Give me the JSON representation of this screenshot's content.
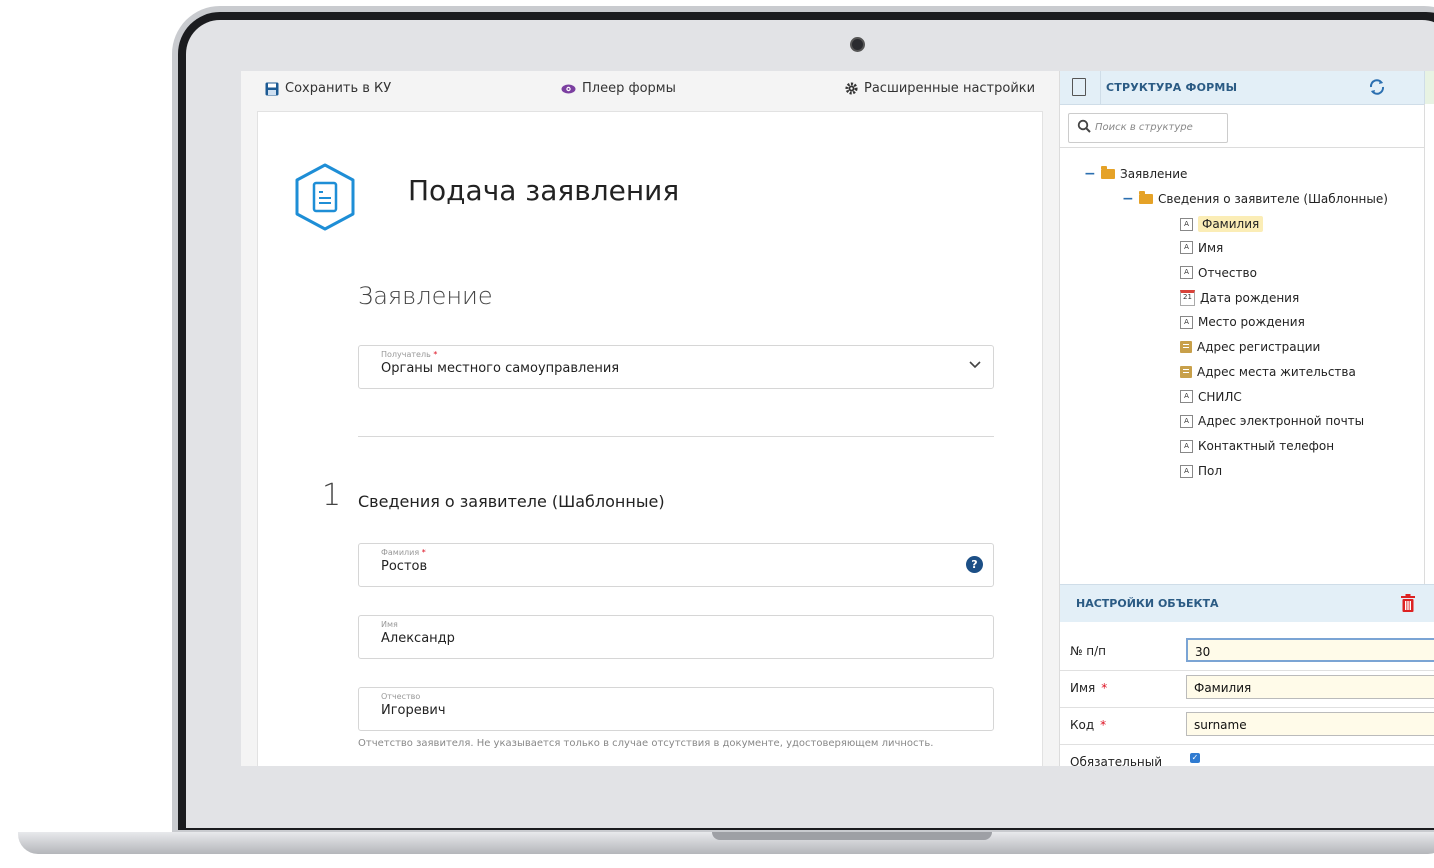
{
  "toolbar": {
    "save": "Сохранить в КУ",
    "player": "Плеер формы",
    "settings": "Расширенные настройки"
  },
  "form": {
    "title": "Подача заявления",
    "section": "Заявление",
    "recipient": {
      "label": "Получатель",
      "value": "Органы местного самоуправления"
    },
    "step_number": "1",
    "step_title": "Сведения о заявителе (Шаблонные)",
    "surname": {
      "label": "Фамилия",
      "value": "Ростов"
    },
    "name": {
      "label": "Имя",
      "value": "Александр"
    },
    "patronymic": {
      "label": "Отчество",
      "value": "Игоревич"
    },
    "patronymic_hint": "Отчетство заявителя. Не указывается только в случае отсутствия в документе, удостоверяющем личность.",
    "required_mark": "*",
    "help_mark": "?"
  },
  "structure": {
    "title": "СТРУКТУРА ФОРМЫ",
    "search_placeholder": "Поиск в структуре",
    "root": "Заявление",
    "group": "Сведения о заявителе (Шаблонные)",
    "items": [
      {
        "label": "Фамилия",
        "icon": "text-field-icon",
        "selected": true
      },
      {
        "label": "Имя",
        "icon": "text-field-icon"
      },
      {
        "label": "Отчество",
        "icon": "text-field-icon"
      },
      {
        "label": "Дата рождения",
        "icon": "calendar-icon",
        "icon_text": "21"
      },
      {
        "label": "Место рождения",
        "icon": "text-field-icon"
      },
      {
        "label": "Адрес регистрации",
        "icon": "address-book-icon"
      },
      {
        "label": "Адрес места жительства",
        "icon": "address-book-icon"
      },
      {
        "label": "СНИЛС",
        "icon": "text-field-icon"
      },
      {
        "label": "Адрес электронной почты",
        "icon": "text-field-icon"
      },
      {
        "label": "Контактный телефон",
        "icon": "text-field-icon"
      },
      {
        "label": "Пол",
        "icon": "text-field-icon"
      }
    ],
    "text_icon_glyph": "A"
  },
  "properties": {
    "title": "НАСТРОЙКИ ОБЪЕКТА",
    "rows": [
      {
        "label": "№ п/п",
        "value": "30"
      },
      {
        "label": "Имя",
        "value": "Фамилия",
        "required": "*"
      },
      {
        "label": "Код",
        "value": "surname",
        "required": "*"
      },
      {
        "label": "Обязательный",
        "checked": true
      }
    ]
  },
  "colors": {
    "accent": "#2b6fb0",
    "header_bg": "#e3eff7",
    "selected": "#fbedb6",
    "brand_icon": "#1e8ed6"
  }
}
